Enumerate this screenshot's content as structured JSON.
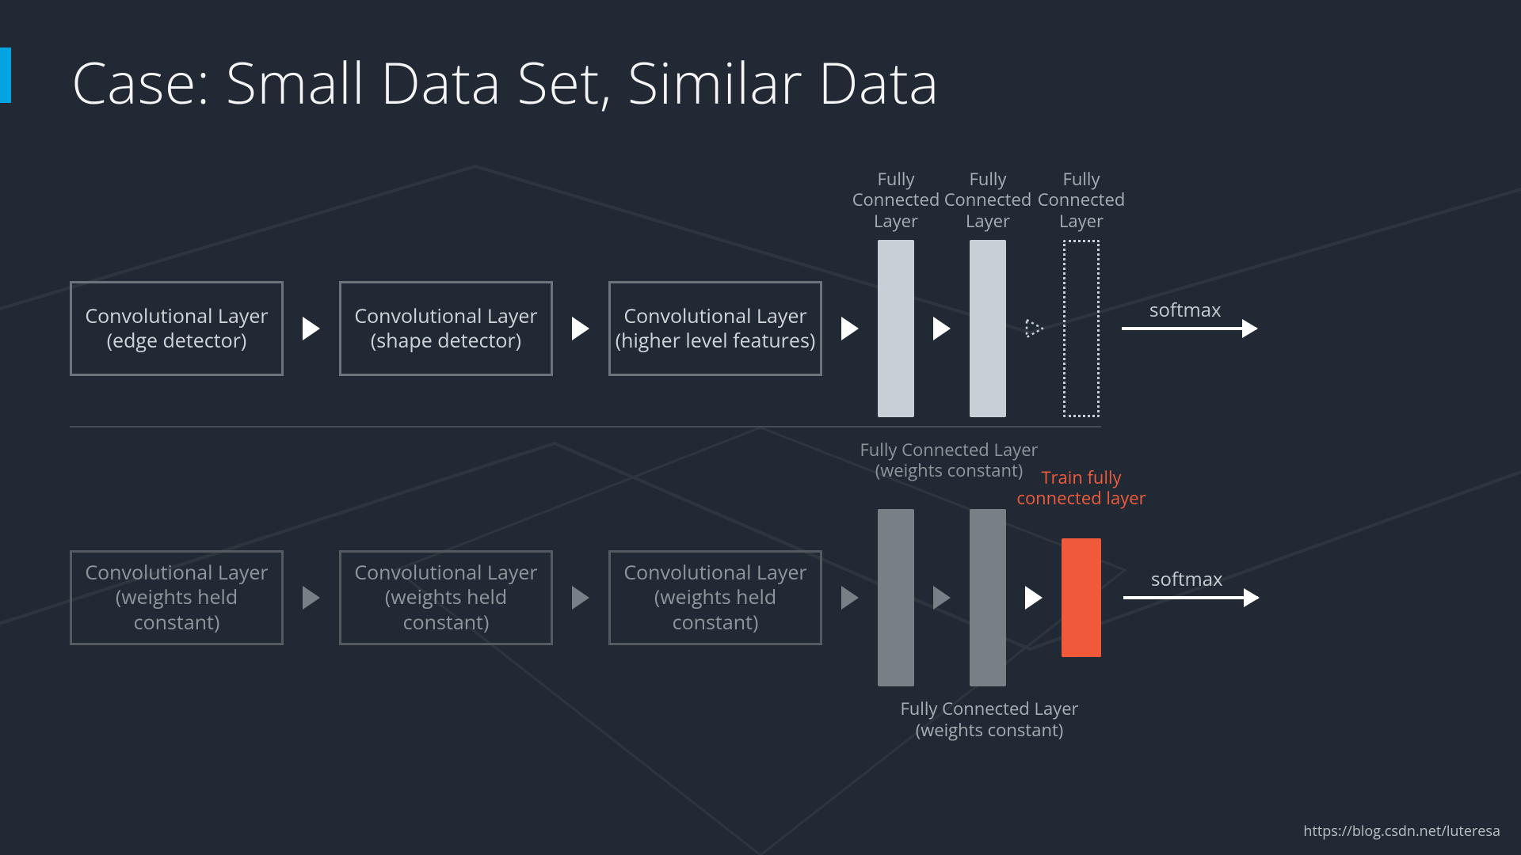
{
  "title": "Case: Small Data Set, Similar Data",
  "row1": {
    "conv": [
      "Convolutional Layer (edge detector)",
      "Convolutional Layer (shape detector)",
      "Convolutional Layer (higher level features)"
    ],
    "fc_label": "Fully Connected Layer",
    "softmax": "softmax"
  },
  "row2": {
    "conv": [
      "Convolutional Layer (weights held constant)",
      "Convolutional Layer (weights held constant)",
      "Convolutional Layer (weights held constant)"
    ],
    "fc_top_label": "Fully Connected Layer (weights constant)",
    "fc_bottom_label": "Fully Connected Layer (weights constant)",
    "train_label": "Train fully connected layer",
    "softmax": "softmax"
  },
  "watermark": "https://blog.csdn.net/luteresa"
}
